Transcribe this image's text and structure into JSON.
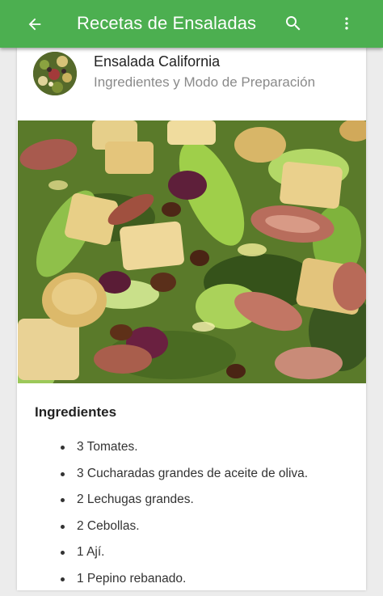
{
  "appbar": {
    "title": "Recetas de Ensaladas",
    "back_icon": "arrow-back-icon",
    "search_icon": "search-icon",
    "more_icon": "more-vert-icon",
    "color": "#4caf50"
  },
  "recipe": {
    "title": "Ensalada California",
    "subtitle": "Ingredientes y Modo de Preparación"
  },
  "ingredients": {
    "heading": "Ingredientes",
    "items": [
      "3 Tomates.",
      "3 Cucharadas grandes de aceite de oliva.",
      "2 Lechugas grandes.",
      "2 Cebollas.",
      "1 Ají.",
      "1 Pepino rebanado."
    ]
  }
}
